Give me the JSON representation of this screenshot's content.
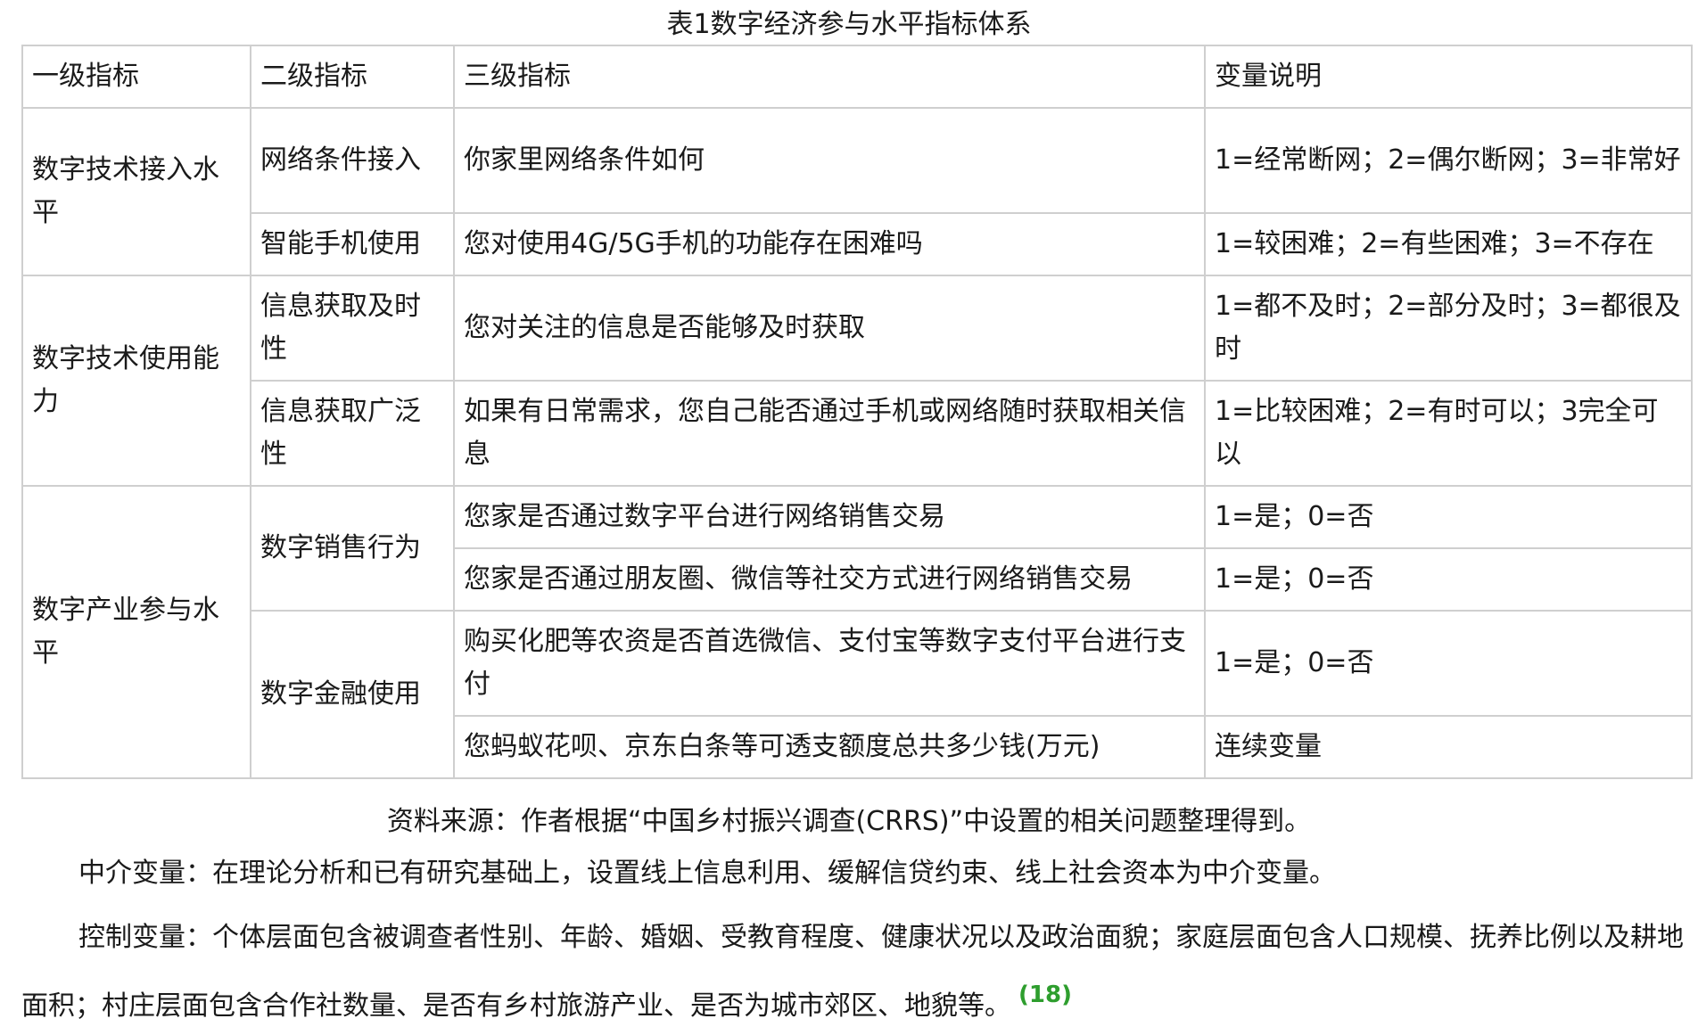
{
  "caption": "表1数字经济参与水平指标体系",
  "table": {
    "headers": [
      "一级指标",
      "二级指标",
      "三级指标",
      "变量说明"
    ],
    "level1": [
      "数字技术接入水平",
      "数字技术使用能力",
      "数字产业参与水平"
    ],
    "level2": [
      "网络条件接入",
      "智能手机使用",
      "信息获取及时性",
      "信息获取广泛性",
      "数字销售行为",
      "数字金融使用"
    ],
    "level3": [
      "你家里网络条件如何",
      "您对使用4G/5G手机的功能存在困难吗",
      "您对关注的信息是否能够及时获取",
      "如果有日常需求，您自己能否通过手机或网络随时获取相关信息",
      "您家是否通过数字平台进行网络销售交易",
      "您家是否通过朋友圈、微信等社交方式进行网络销售交易",
      "购买化肥等农资是否首选微信、支付宝等数字支付平台进行支付",
      "您蚂蚁花呗、京东白条等可透支额度总共多少钱(万元)"
    ],
    "variable_desc": [
      "1=经常断网；2=偶尔断网；3=非常好",
      "1=较困难；2=有些困难；3=不存在",
      "1=都不及时；2=部分及时；3=都很及时",
      "1=比较困难；2=有时可以；3完全可以",
      "1=是；0=否",
      "1=是；0=否",
      "1=是；0=否",
      "连续变量"
    ]
  },
  "source_note": "资料来源：作者根据“中国乡村振兴调查(CRRS)”中设置的相关问题整理得到。",
  "paragraphs": {
    "mediator": "中介变量：在理论分析和已有研究基础上，设置线上信息利用、缓解信贷约束、线上社会资本为中介变量。",
    "control": "控制变量：个体层面包含被调查者性别、年龄、婚姻、受教育程度、健康状况以及政治面貌；家庭层面包含人口规模、抚养比例以及耕地面积；村庄层面包含合作社数量、是否有乡村旅游产业、是否为城市郊区、地貌等。",
    "control_ref": "(18)"
  },
  "colors": {
    "text": "#1a1a1a",
    "border": "#cfcfcf",
    "ref": "#2e9e2e"
  }
}
